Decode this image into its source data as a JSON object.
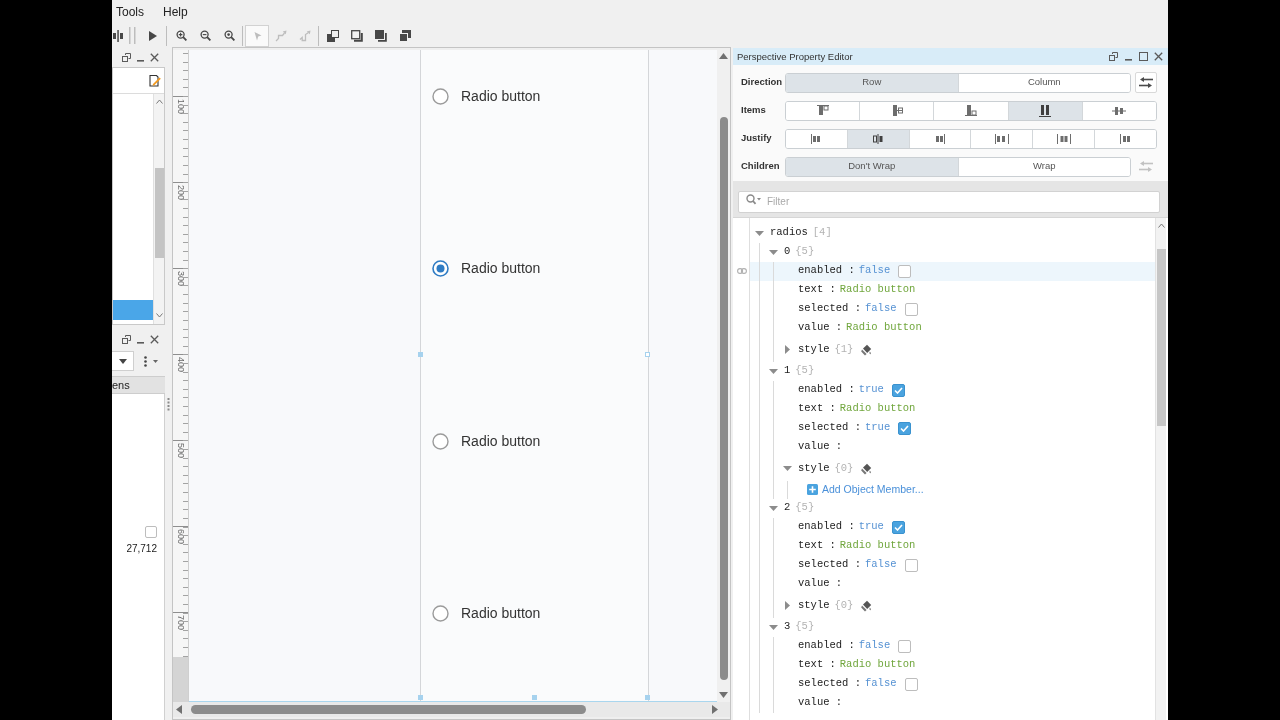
{
  "menu_bar": [
    {
      "label": "Tools"
    },
    {
      "label": "Help"
    }
  ],
  "toolbar": [
    {
      "items": [
        {
          "kind": "columns",
          "disabled": false,
          "pressed": false
        },
        {
          "kind": "handle",
          "disabled": true,
          "pressed": false
        },
        {
          "kind": "play",
          "disabled": false,
          "pressed": false
        }
      ]
    },
    {
      "items": [
        {
          "kind": "zoom_in",
          "disabled": false,
          "pressed": false
        },
        {
          "kind": "zoom_out",
          "disabled": false,
          "pressed": false
        },
        {
          "kind": "zoom_reset",
          "disabled": false,
          "pressed": false
        }
      ]
    },
    {
      "items": [
        {
          "kind": "pointer",
          "disabled": true,
          "pressed": true
        },
        {
          "kind": "path_a",
          "disabled": true,
          "pressed": false
        },
        {
          "kind": "path_b",
          "disabled": true,
          "pressed": false
        }
      ]
    },
    {
      "items": [
        {
          "kind": "front",
          "disabled": false,
          "pressed": false
        },
        {
          "kind": "back_outline",
          "disabled": false,
          "pressed": false
        },
        {
          "kind": "back_filled",
          "disabled": false,
          "pressed": false
        },
        {
          "kind": "stack",
          "disabled": false,
          "pressed": false
        }
      ]
    }
  ],
  "left_dock": {
    "upper_panel": {
      "rows": [
        {
          "selected": true
        }
      ]
    },
    "lower_panel": {
      "column_header": "ens",
      "checkbox": {
        "checked": false
      },
      "value": "27,712"
    }
  },
  "designer": {
    "ruler_labels": [
      "100",
      "200",
      "300",
      "400",
      "500",
      "600",
      "700"
    ],
    "radios": [
      {
        "label": "Radio button",
        "selected": false
      },
      {
        "label": "Radio button",
        "selected": true
      },
      {
        "label": "Radio button",
        "selected": false
      },
      {
        "label": "Radio button",
        "selected": false
      }
    ]
  },
  "property_editor": {
    "title": "Perspective Property Editor",
    "layout_rows": [
      {
        "label": "Direction",
        "kind": "text",
        "options": [
          {
            "label": "Row",
            "selected": true
          },
          {
            "label": "Column",
            "selected": false
          }
        ],
        "swap": {
          "disabled": false
        }
      },
      {
        "label": "Items",
        "kind": "icons",
        "options": [
          {
            "kind": "align_start",
            "selected": false
          },
          {
            "kind": "align_center",
            "selected": false
          },
          {
            "kind": "align_end",
            "selected": false
          },
          {
            "kind": "align_stretch",
            "selected": true
          },
          {
            "kind": "align_baseline",
            "selected": false
          }
        ]
      },
      {
        "label": "Justify",
        "kind": "icons",
        "options": [
          {
            "kind": "justify_start",
            "selected": false
          },
          {
            "kind": "justify_center",
            "selected": true
          },
          {
            "kind": "justify_end",
            "selected": false
          },
          {
            "kind": "justify_between",
            "selected": false
          },
          {
            "kind": "justify_around",
            "selected": false
          },
          {
            "kind": "justify_evenly",
            "selected": false
          }
        ]
      },
      {
        "label": "Children",
        "kind": "text",
        "options": [
          {
            "label": "Don't Wrap",
            "selected": true
          },
          {
            "label": "Wrap",
            "selected": false
          }
        ],
        "swap": {
          "disabled": true
        }
      }
    ],
    "filter": {
      "placeholder": "Filter"
    },
    "tree": [
      {
        "kind": "array",
        "key": "radios",
        "count": "[4]",
        "expanded": true,
        "selected": false,
        "children": [
          {
            "kind": "object",
            "key": "0",
            "count": "{5}",
            "expanded": true,
            "selected": false,
            "children": [
              {
                "kind": "boolean",
                "key": "enabled :",
                "value": "false",
                "checked": false,
                "selected": true
              },
              {
                "kind": "string",
                "key": "text :",
                "value": "Radio button",
                "selected": false
              },
              {
                "kind": "boolean",
                "key": "selected :",
                "value": "false",
                "checked": false,
                "selected": false
              },
              {
                "kind": "string",
                "key": "value :",
                "value": "Radio button",
                "selected": false
              },
              {
                "kind": "style",
                "key": "style",
                "count": "{1}",
                "expanded": false,
                "selected": false
              }
            ]
          },
          {
            "kind": "object",
            "key": "1",
            "count": "{5}",
            "expanded": true,
            "selected": false,
            "children": [
              {
                "kind": "boolean",
                "key": "enabled :",
                "value": "true",
                "checked": true,
                "selected": false
              },
              {
                "kind": "string",
                "key": "text :",
                "value": "Radio button",
                "selected": false
              },
              {
                "kind": "boolean",
                "key": "selected :",
                "value": "true",
                "checked": true,
                "selected": false
              },
              {
                "kind": "string",
                "key": "value :",
                "selected": false
              },
              {
                "kind": "style",
                "key": "style",
                "count": "{0}",
                "expanded": true,
                "selected": false,
                "children": [
                  {
                    "kind": "add",
                    "label": "Add Object Member...",
                    "selected": false
                  }
                ]
              }
            ]
          },
          {
            "kind": "object",
            "key": "2",
            "count": "{5}",
            "expanded": true,
            "selected": false,
            "children": [
              {
                "kind": "boolean",
                "key": "enabled :",
                "value": "true",
                "checked": true,
                "selected": false
              },
              {
                "kind": "string",
                "key": "text :",
                "value": "Radio button",
                "selected": false
              },
              {
                "kind": "boolean",
                "key": "selected :",
                "value": "false",
                "checked": false,
                "selected": false
              },
              {
                "kind": "string",
                "key": "value :",
                "selected": false
              },
              {
                "kind": "style",
                "key": "style",
                "count": "{0}",
                "expanded": false,
                "selected": false
              }
            ]
          },
          {
            "kind": "object",
            "key": "3",
            "count": "{5}",
            "expanded": true,
            "selected": false,
            "children": [
              {
                "kind": "boolean",
                "key": "enabled :",
                "value": "false",
                "checked": false,
                "selected": false
              },
              {
                "kind": "string",
                "key": "text :",
                "value": "Radio button",
                "selected": false
              },
              {
                "kind": "boolean",
                "key": "selected :",
                "value": "false",
                "checked": false,
                "selected": false
              },
              {
                "kind": "string",
                "key": "value :",
                "selected": false
              }
            ]
          }
        ]
      }
    ]
  }
}
